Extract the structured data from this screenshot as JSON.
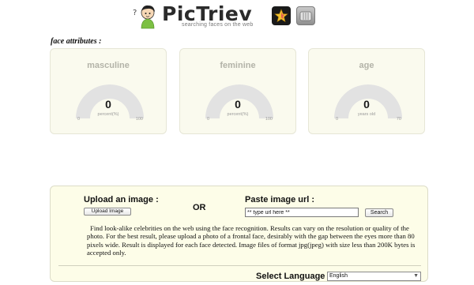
{
  "header": {
    "logo_title": "PicTriev",
    "tagline": "searching faces on the web",
    "icons": [
      "mascot-icon",
      "star-icon",
      "camera-icon"
    ]
  },
  "face_attributes": {
    "label": "face attributes :",
    "gauges": [
      {
        "title": "masculine",
        "value": "0",
        "unit": "percent(%)",
        "min": "0",
        "max": "100",
        "level": 0
      },
      {
        "title": "feminine",
        "value": "0",
        "unit": "percent(%)",
        "min": "0",
        "max": "100",
        "level": 0
      },
      {
        "title": "age",
        "value": "0",
        "unit": "years old",
        "min": "0",
        "max": "70",
        "level": 0
      }
    ]
  },
  "upload": {
    "heading": "Upload an image :",
    "button_label": "Upload Image",
    "or_label": "OR",
    "url_heading": "Paste image url :",
    "url_value": "** type url here **",
    "search_label": "Search",
    "description": "Find look-alike celebrities on the web using the face recognition. Results can vary on the resolution or quality of the photo. For the best result, please upload a photo of a frontal face, desirably with the gap between the eyes more than 80 pixels wide. Result is displayed for each face detected. Image files of format jpg(jpeg) with size less than 200K bytes is accepted only.",
    "language_label": "Select Language",
    "language_value": "English"
  },
  "colors": {
    "card_bg": "#fafaee",
    "panel_bg": "#fdfde8",
    "gauge_track": "#e2e2e2",
    "title_gray": "#b3b3a8"
  }
}
